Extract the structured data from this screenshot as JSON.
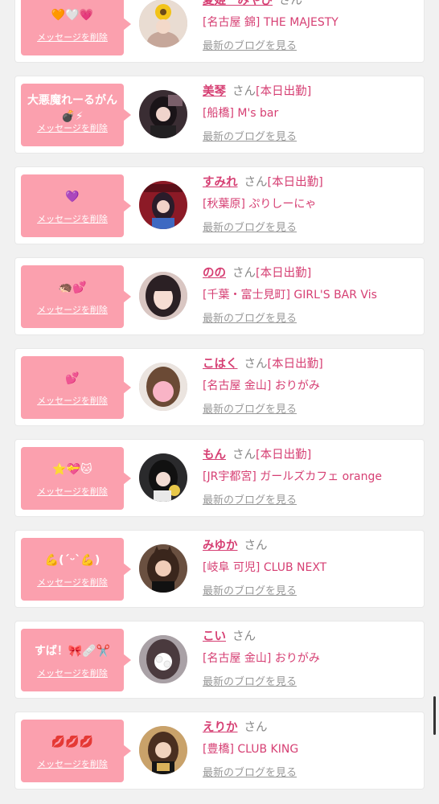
{
  "delete_label": "メッセージを削除",
  "blog_label": "最新のブログを見る",
  "san_label": "さん",
  "today_label": "[本日出勤]",
  "colors": {
    "bubble": "#fba0ae",
    "name": "#d63f73",
    "muted": "#888888"
  },
  "cards": [
    {
      "message": "🧡🤍💗",
      "name": "夏姫　みやび",
      "today": false,
      "shop": "[名古屋 錦] THE MAJESTY"
    },
    {
      "message": "大悪魔れーるがん\n💣⚡",
      "name": "美琴",
      "today": true,
      "shop": "[船橋] M's bar"
    },
    {
      "message": "💜",
      "name": "すみれ",
      "today": true,
      "shop": "[秋葉原] ぷりしーにゃ"
    },
    {
      "message": "🦔💕",
      "name": "のの",
      "today": true,
      "shop": "[千葉・富士見町] GIRL'S BAR Vis"
    },
    {
      "message": "💕",
      "name": "こはく",
      "today": true,
      "shop": "[名古屋 金山] おりがみ"
    },
    {
      "message": "⭐💝🐱",
      "name": "もん",
      "today": true,
      "shop": "[JR宇都宮] ガールズカフェ orange"
    },
    {
      "message": "💪(ˊᵕˋ💪)",
      "name": "みゆか",
      "today": false,
      "shop": "[岐阜 可児] CLUB NEXT"
    },
    {
      "message": "すば！🎀🩹✂️",
      "name": "こい",
      "today": false,
      "shop": "[名古屋 金山] おりがみ"
    },
    {
      "message": "💋💋💋",
      "name": "えりか",
      "today": false,
      "shop": "[豊橋] CLUB KING"
    }
  ]
}
